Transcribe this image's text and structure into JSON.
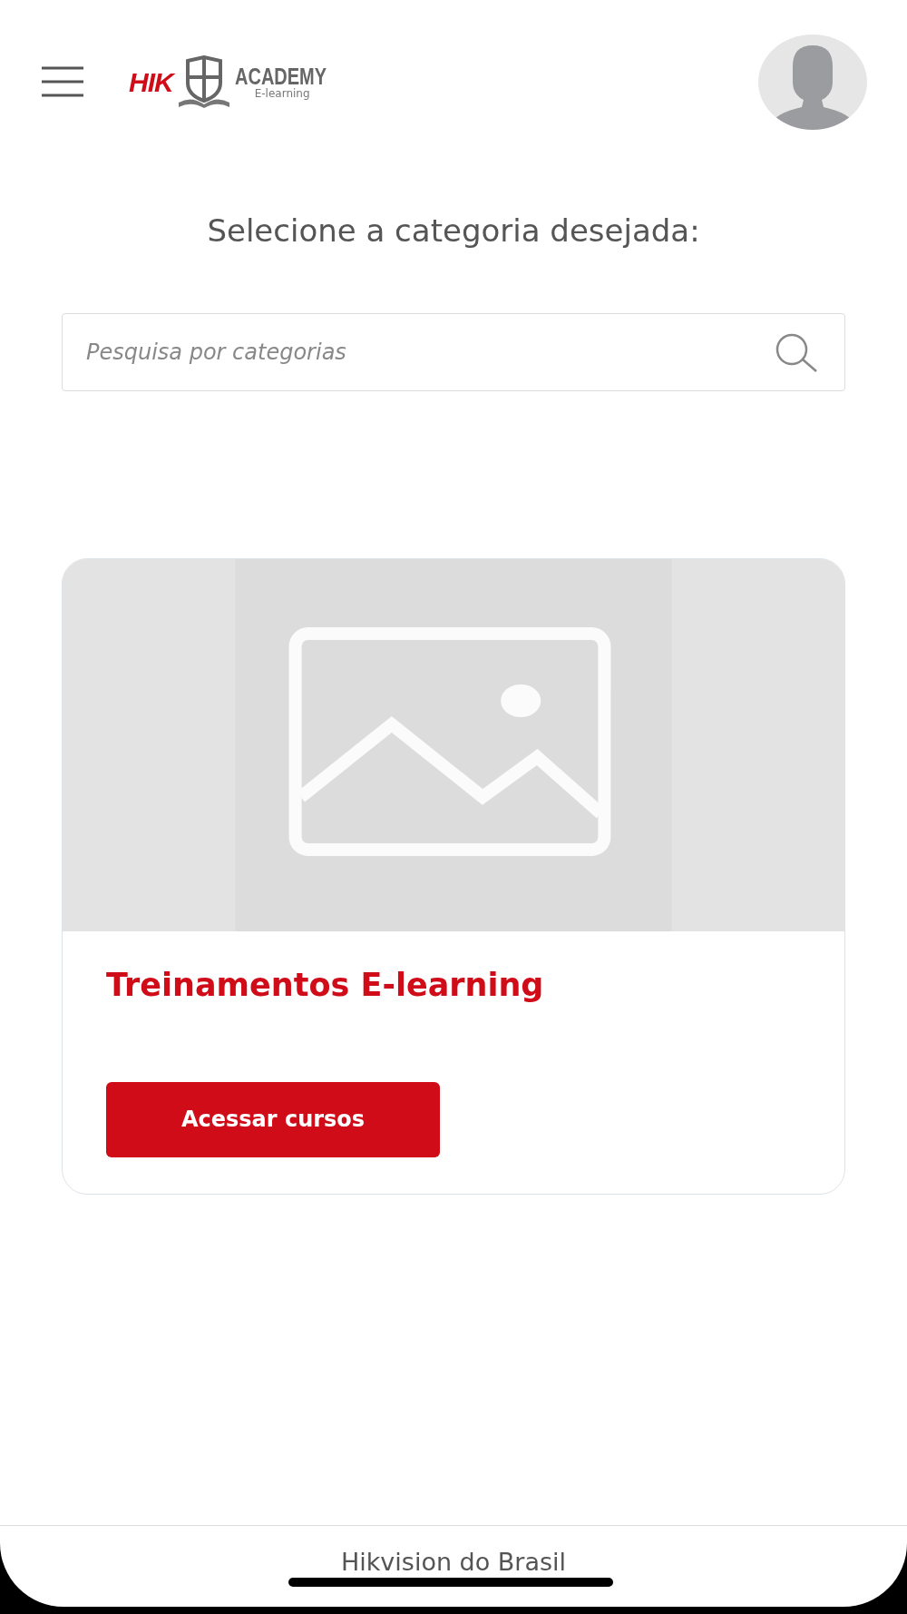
{
  "header": {
    "logo": {
      "brand": "HIK",
      "name": "ACADEMY",
      "tagline": "E-learning"
    }
  },
  "heading": "Selecione a categoria desejada:",
  "search": {
    "placeholder": "Pesquisa por categorias"
  },
  "categories": [
    {
      "kind": "picture",
      "title": "Treinamentos E-learning",
      "button": "Acessar cursos"
    }
  ],
  "footer": {
    "text": "Hikvision do Brasil"
  }
}
